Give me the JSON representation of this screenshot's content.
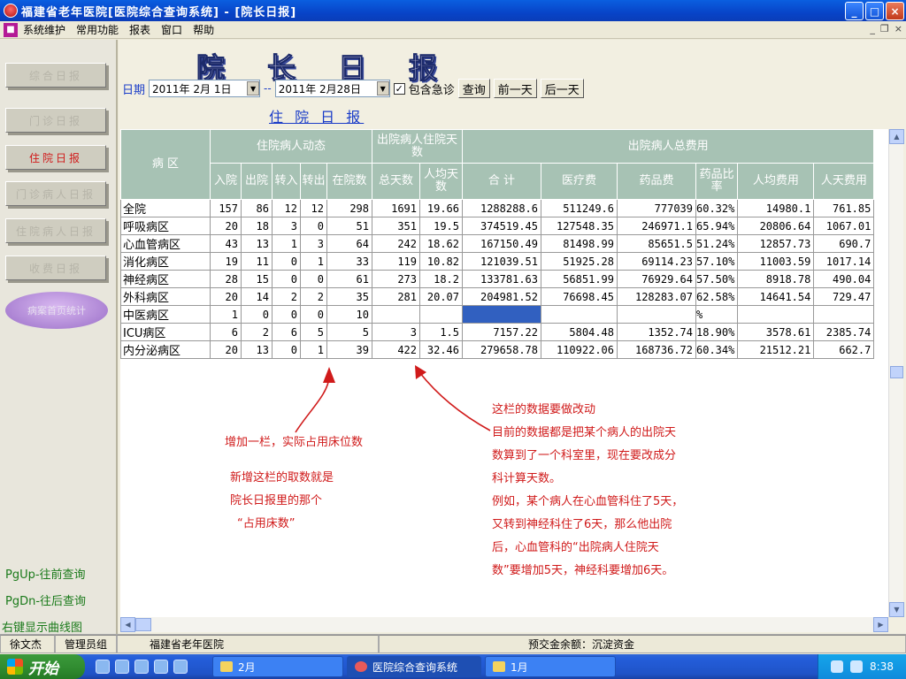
{
  "window": {
    "title": "福建省老年医院[医院综合查询系统] - [院长日报]",
    "buttons": {
      "minimize": "_",
      "maximize": "□",
      "close": "×"
    }
  },
  "menu": [
    "系统维护",
    "常用功能",
    "报表",
    "窗口",
    "帮助"
  ],
  "mdi_buttons": {
    "minimize": "_",
    "restore": "❐",
    "close": "×"
  },
  "sidebar": {
    "buttons": [
      "综合日报",
      "门诊日报",
      "住院日报",
      "门诊病人日报",
      "住院病人日报",
      "收费日报"
    ],
    "oval": "病案首页统计",
    "hints": [
      "PgUp-往前查询",
      "PgDn-往后查询",
      "右键显示曲线图"
    ]
  },
  "report": {
    "big_title": [
      "院",
      "长",
      "日",
      "报"
    ],
    "date_label": "日期",
    "date_from": "2011年 2月 1日",
    "separator": "--",
    "date_to": "2011年 2月28日",
    "include_emergency_label": "包含急诊",
    "include_emergency_checked": "✓",
    "query_button": "查询",
    "prev_day_button": "前一天",
    "next_day_button": "后一天",
    "subtitle": "住 院 日 报"
  },
  "table": {
    "group_headers": {
      "ward": "病 区",
      "inpatient_dynamics": "住院病人动态",
      "discharged_days": "出院病人住院天数",
      "discharged_costs": "出院病人总费用"
    },
    "columns": [
      "入院",
      "出院",
      "转入",
      "转出",
      "在院数",
      "总天数",
      "人均天数",
      "合 计",
      "医疗费",
      "药品费",
      "药品比率",
      "人均费用",
      "人天费用"
    ],
    "rows": [
      [
        "全院",
        "157",
        "86",
        "12",
        "12",
        "298",
        "1691",
        "19.66",
        "1288288.6",
        "511249.6",
        "777039",
        "60.32%",
        "14980.1",
        "761.85"
      ],
      [
        "呼吸病区",
        "20",
        "18",
        "3",
        "0",
        "51",
        "351",
        "19.5",
        "374519.45",
        "127548.35",
        "246971.1",
        "65.94%",
        "20806.64",
        "1067.01"
      ],
      [
        "心血管病区",
        "43",
        "13",
        "1",
        "3",
        "64",
        "242",
        "18.62",
        "167150.49",
        "81498.99",
        "85651.5",
        "51.24%",
        "12857.73",
        "690.7"
      ],
      [
        "消化病区",
        "19",
        "11",
        "0",
        "1",
        "33",
        "119",
        "10.82",
        "121039.51",
        "51925.28",
        "69114.23",
        "57.10%",
        "11003.59",
        "1017.14"
      ],
      [
        "神经病区",
        "28",
        "15",
        "0",
        "0",
        "61",
        "273",
        "18.2",
        "133781.63",
        "56851.99",
        "76929.64",
        "57.50%",
        "8918.78",
        "490.04"
      ],
      [
        "外科病区",
        "20",
        "14",
        "2",
        "2",
        "35",
        "281",
        "20.07",
        "204981.52",
        "76698.45",
        "128283.07",
        "62.58%",
        "14641.54",
        "729.47"
      ],
      [
        "中医病区",
        "1",
        "0",
        "0",
        "0",
        "10",
        "",
        "",
        "",
        "",
        "",
        "%",
        "",
        ""
      ],
      [
        "ICU病区",
        "6",
        "2",
        "6",
        "5",
        "5",
        "3",
        "1.5",
        "7157.22",
        "5804.48",
        "1352.74",
        "18.90%",
        "3578.61",
        "2385.74"
      ],
      [
        "内分泌病区",
        "20",
        "13",
        "0",
        "1",
        "39",
        "422",
        "32.46",
        "279658.78",
        "110922.06",
        "168736.72",
        "60.34%",
        "21512.21",
        "662.7"
      ]
    ]
  },
  "annotations": {
    "note1": "增加一栏，实际占用床位数",
    "note2": [
      "新增这栏的取数就是",
      "院长日报里的那个",
      "“占用床数”"
    ],
    "note3": [
      "这栏的数据要做改动",
      "目前的数据都是把某个病人的出院天",
      "数算到了一个科室里，现在要改成分",
      "科计算天数。",
      "例如，某个病人在心血管科住了5天，",
      "又转到神经科住了6天，那么他出院",
      "后，心血管科的“出院病人住院天",
      "数”要增加5天，神经科要增加6天。"
    ],
    "color": "#d01a1a"
  },
  "statusbar": [
    "徐文杰",
    "管理员组",
    "福建省老年医院",
    "预交金余额：沉淀资金"
  ],
  "taskbar": {
    "start": "开始",
    "tasks": [
      "2月",
      "医院综合查询系统",
      "1月"
    ],
    "clock": "8:38"
  }
}
